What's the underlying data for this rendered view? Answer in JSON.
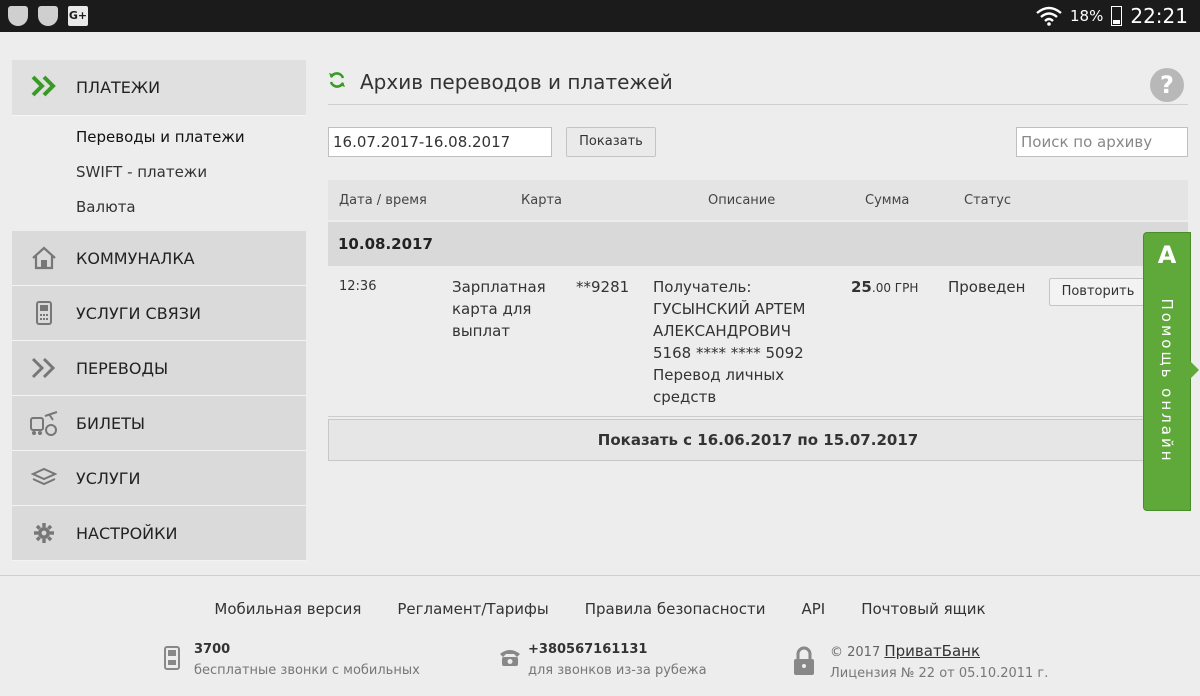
{
  "status_bar": {
    "battery": "18%",
    "time": "22:21",
    "gplus_label": "G+"
  },
  "sidebar": {
    "header_label": "ПЛАТЕЖИ",
    "sub_items": [
      {
        "label": "Переводы и платежи"
      },
      {
        "label": "SWIFT - платежи"
      },
      {
        "label": "Валюта"
      }
    ],
    "items": [
      {
        "label": "КОММУНАЛКА",
        "icon": "house-icon"
      },
      {
        "label": "УСЛУГИ СВЯЗИ",
        "icon": "phone-icon"
      },
      {
        "label": "ПЕРЕВОДЫ",
        "icon": "double-chevron-icon"
      },
      {
        "label": "БИЛЕТЫ",
        "icon": "train-plane-icon"
      },
      {
        "label": "УСЛУГИ",
        "icon": "layers-icon"
      },
      {
        "label": "НАСТРОЙКИ",
        "icon": "gear-icon"
      }
    ]
  },
  "main": {
    "title": "Архив переводов и платежей",
    "help_symbol": "?",
    "date_range": "16.07.2017-16.08.2017",
    "show_button": "Показать",
    "search_placeholder": "Поиск по архиву",
    "columns": [
      "Дата / время",
      "Карта",
      "Описание",
      "Сумма",
      "Статус"
    ],
    "group_date": "10.08.2017",
    "row": {
      "time": "12:36",
      "card_name": "Зарплатная карта для выплат",
      "card_number": "**9281",
      "description": [
        "Получатель:",
        "ГУСЫНСКИЙ АРТЕМ",
        "АЛЕКСАНДРОВИЧ",
        "5168 **** **** 5092",
        "Перевод личных",
        "средств"
      ],
      "amount_int": "25",
      "amount_dec": ".00 ГРН",
      "status": "Проведен",
      "repeat_button": "Повторить"
    },
    "more_button": "Показать с 16.06.2017 по 15.07.2017"
  },
  "help_online": {
    "symbol": "А",
    "label": "Помощь онлайн"
  },
  "footer": {
    "links": [
      "Мобильная версия",
      "Регламент/Тарифы",
      "Правила безопасности",
      "API",
      "Почтовый ящик"
    ],
    "phone_mobile": "3700",
    "phone_mobile_note": "бесплатные звонки с мобильных",
    "phone_abroad": "+380567161131",
    "phone_abroad_note": "для звонков из-за рубежа",
    "copyright_prefix": "© 2017",
    "bank_link": "ПриватБанк",
    "license": "Лицензия № 22 от 05.10.2011 г."
  },
  "colors": {
    "accent_green": "#5fa83a",
    "status_bar": "#1b1b1b",
    "background": "#ededed"
  }
}
